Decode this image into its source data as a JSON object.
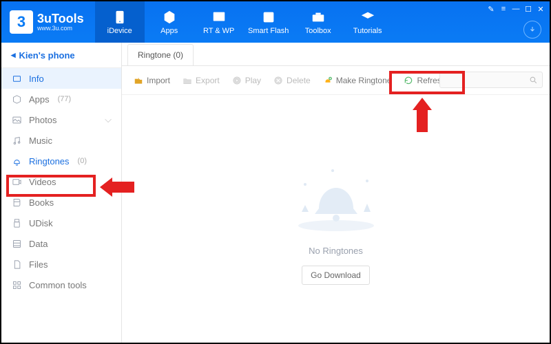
{
  "logo": {
    "mark": "3",
    "name": "3uTools",
    "site": "www.3u.com"
  },
  "topnav": [
    {
      "label": "iDevice",
      "active": true
    },
    {
      "label": "Apps"
    },
    {
      "label": "RT & WP"
    },
    {
      "label": "Smart Flash"
    },
    {
      "label": "Toolbox"
    },
    {
      "label": "Tutorials"
    }
  ],
  "device_name": "Kien's phone",
  "sidebar": [
    {
      "label": "Info",
      "key": "info"
    },
    {
      "label": "Apps",
      "count": "(77)",
      "key": "apps"
    },
    {
      "label": "Photos",
      "key": "photos",
      "chev": true
    },
    {
      "label": "Music",
      "key": "music"
    },
    {
      "label": "Ringtones",
      "count": "(0)",
      "key": "ringtones"
    },
    {
      "label": "Videos",
      "key": "videos"
    },
    {
      "label": "Books",
      "key": "books"
    },
    {
      "label": "UDisk",
      "key": "udisk"
    },
    {
      "label": "Data",
      "key": "data"
    },
    {
      "label": "Files",
      "key": "files"
    },
    {
      "label": "Common tools",
      "key": "common"
    }
  ],
  "tab_label": "Ringtone (0)",
  "toolbar": {
    "import": "Import",
    "export": "Export",
    "play": "Play",
    "delete": "Delete",
    "make": "Make Ringtone",
    "refresh": "Refresh"
  },
  "empty": {
    "text": "No Ringtones",
    "button": "Go Download"
  }
}
